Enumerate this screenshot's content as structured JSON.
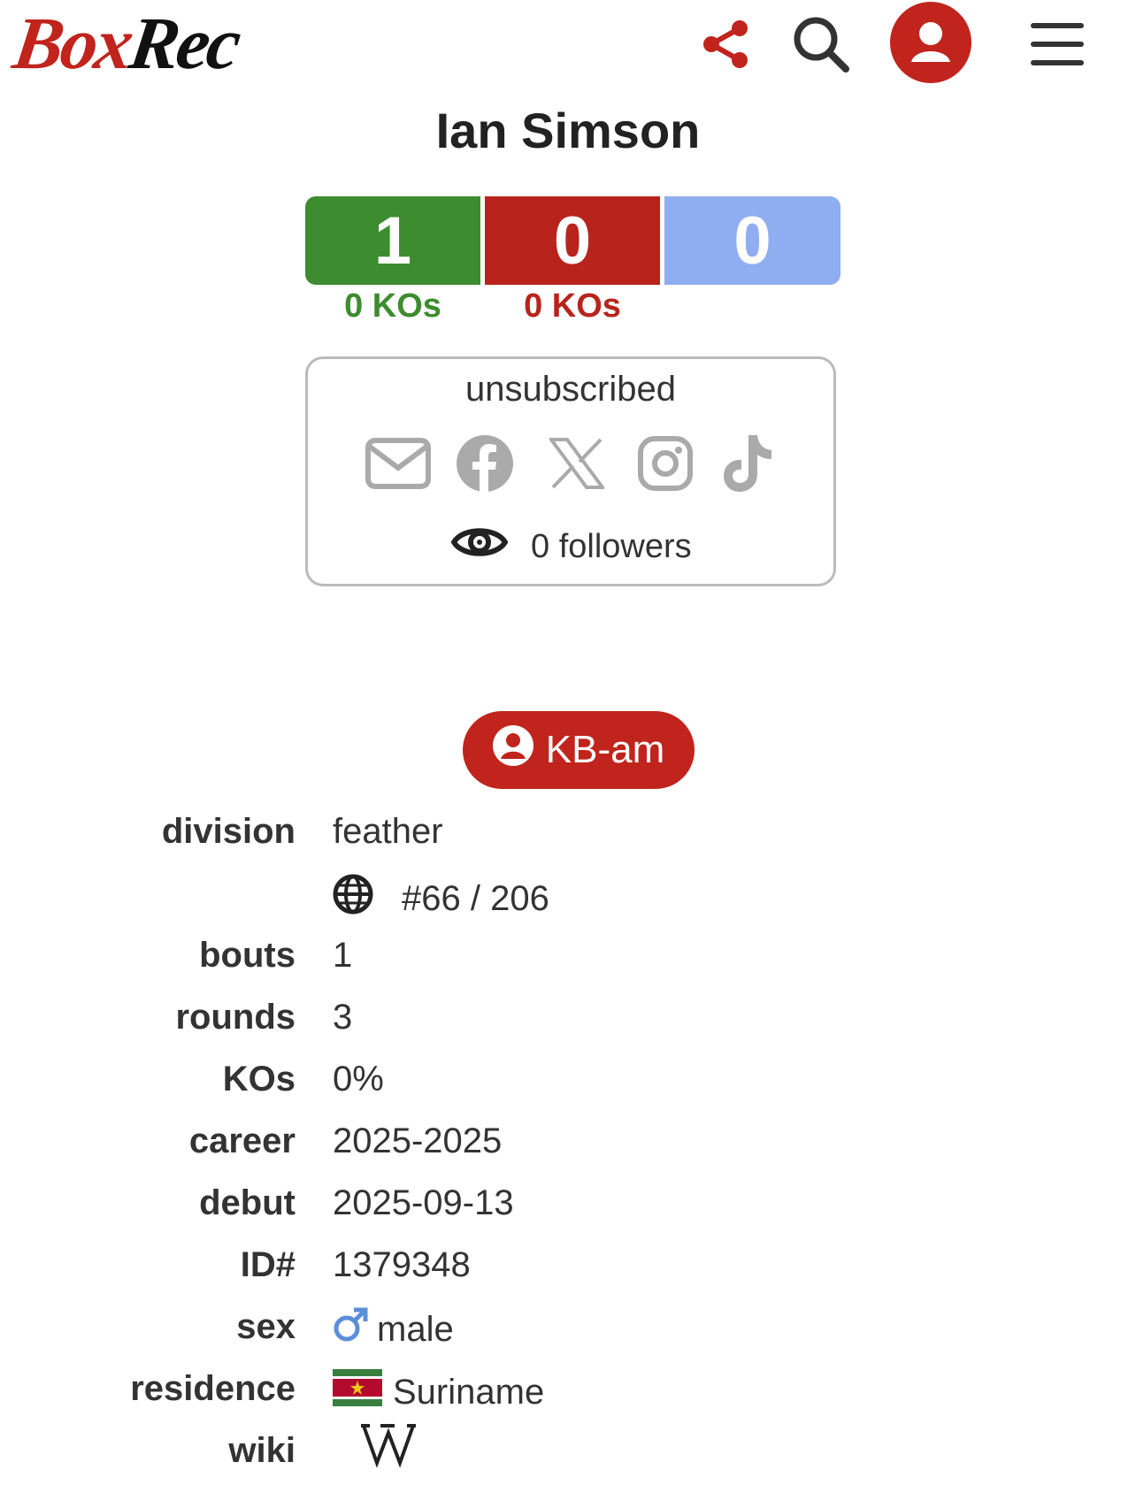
{
  "header": {
    "logo_part1": "Box",
    "logo_part2": "Rec",
    "icons": [
      "share-icon",
      "search-icon",
      "user-account-icon",
      "menu-icon"
    ],
    "brand_color": "#c0241c"
  },
  "boxer": {
    "name": "Ian Simson",
    "record": {
      "wins": "1",
      "losses": "0",
      "draws": "0"
    },
    "wins_kos": "0 KOs",
    "losses_kos": "0 KOs"
  },
  "subscription": {
    "status": "unsubscribed",
    "icons": [
      "email-icon",
      "facebook-icon",
      "x-icon",
      "instagram-icon",
      "tiktok-icon"
    ],
    "followers": "0 followers"
  },
  "badge": {
    "label": "KB-am"
  },
  "info": {
    "division_label": "division",
    "division_value": "feather",
    "ranking_value": "#66 / 206",
    "bouts_label": "bouts",
    "bouts_value": "1",
    "rounds_label": "rounds",
    "rounds_value": "3",
    "kos_label": "KOs",
    "kos_value": "0%",
    "career_label": "career",
    "career_value": "2025-2025",
    "debut_label": "debut",
    "debut_value": "2025-09-13",
    "id_label": "ID#",
    "id_value": "1379348",
    "sex_label": "sex",
    "sex_value": "male",
    "residence_label": "residence",
    "residence_value": "Suriname",
    "wiki_label": "wiki"
  },
  "colors": {
    "win": "#3d8c2f",
    "loss": "#b8241c",
    "draw": "#8faef2",
    "male_symbol": "#5b8fd9"
  }
}
